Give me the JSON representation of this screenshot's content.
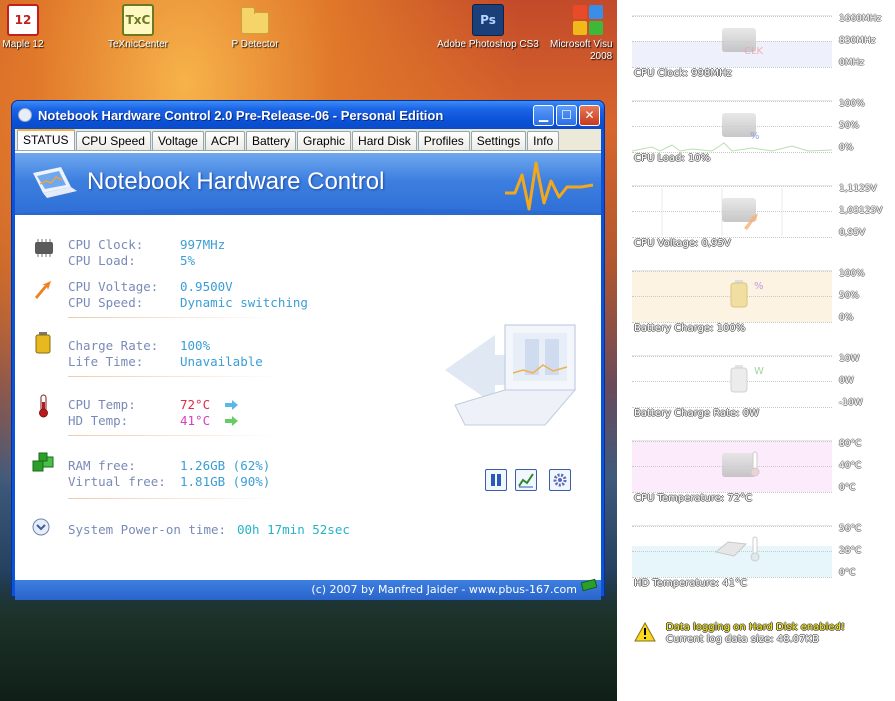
{
  "desktop": {
    "icons": [
      {
        "id": "maple",
        "label": "Maple 12",
        "glyph": "12"
      },
      {
        "id": "texnic",
        "label": "TeXnicCenter",
        "glyph": "TxC"
      },
      {
        "id": "pdetector",
        "label": "P Detector",
        "glyph": ""
      },
      {
        "id": "photoshop",
        "label": "Adobe Photoshop CS3",
        "glyph": "Ps"
      },
      {
        "id": "msvisual",
        "label_line1": "Microsoft Visu",
        "label_line2": "2008"
      }
    ]
  },
  "window": {
    "title": "Notebook Hardware Control 2.0 Pre-Release-06  -  Personal Edition",
    "tabs": [
      "STATUS",
      "CPU Speed",
      "Voltage",
      "ACPI",
      "Battery",
      "Graphic",
      "Hard Disk",
      "Profiles",
      "Settings",
      "Info"
    ],
    "active_tab": "STATUS",
    "banner_title": "Notebook Hardware Control",
    "status": {
      "cpu_clock_label": "CPU Clock:",
      "cpu_clock_value": "997MHz",
      "cpu_load_label": "CPU Load:",
      "cpu_load_value": "5%",
      "cpu_voltage_label": "CPU Voltage:",
      "cpu_voltage_value": "0.9500V",
      "cpu_speed_label": "CPU Speed:",
      "cpu_speed_value": "Dynamic switching",
      "charge_rate_label": "Charge Rate:",
      "charge_rate_value": "100%",
      "life_time_label": "Life Time:",
      "life_time_value": "Unavailable",
      "cpu_temp_label": "CPU Temp:",
      "cpu_temp_value": "72°C",
      "hd_temp_label": "HD Temp:",
      "hd_temp_value": "41°C",
      "ram_free_label": "RAM free:",
      "ram_free_value": "1.26GB (62%)",
      "virtual_free_label": "Virtual free:",
      "virtual_free_value": "1.81GB (90%)",
      "power_on_label": "System Power-on time:",
      "power_on_value": "00h  17min  52sec"
    },
    "footer": "(c) 2007 by Manfred Jaider - www.pbus-167.com",
    "colors": {
      "accent": "#0a53d8",
      "label": "#7a8ab8",
      "value": "#3a9ed6",
      "cpu_temp": "#e02d4a",
      "hd_temp": "#d93fbf",
      "power_on": "#26b3c8"
    }
  },
  "gadgets": [
    {
      "id": "cpu-clock",
      "label": "CPU Clock: 998MHz",
      "axis": [
        "1660MHz",
        "830MHz",
        "0MHz"
      ],
      "overlay": "CLK",
      "bg": "#eef0fb"
    },
    {
      "id": "cpu-load",
      "label": "CPU Load: 10%",
      "axis": [
        "100%",
        "50%",
        "0%"
      ],
      "overlay": "%",
      "bg": "#ffffff"
    },
    {
      "id": "cpu-voltage",
      "label": "CPU Voltage: 0,95V",
      "axis": [
        "1,1125V",
        "1,03125V",
        "0,95V"
      ],
      "overlay": "",
      "bg": "#ffffff"
    },
    {
      "id": "battery-charge",
      "label": "Battery Charge: 100%",
      "axis": [
        "100%",
        "50%",
        "0%"
      ],
      "overlay": "%",
      "bg": "#fdf3e2"
    },
    {
      "id": "battery-rate",
      "label": "Battery Charge Rate: 0W",
      "axis": [
        "10W",
        "0W",
        "-10W"
      ],
      "overlay": "W",
      "bg": "#ffffff"
    },
    {
      "id": "cpu-temp",
      "label": "CPU Temperature: 72°C",
      "axis": [
        "80°C",
        "40°C",
        "0°C"
      ],
      "overlay": "",
      "bg": "#fcebfa"
    },
    {
      "id": "hd-temp",
      "label": "HD Temperature: 41°C",
      "axis": [
        "56°C",
        "28°C",
        "0°C"
      ],
      "overlay": "",
      "bg": "#e7f6fb"
    }
  ],
  "notice": {
    "line1": "Data logging on Hard Disk enabled!",
    "line2": "Current log data size: 48.07KB"
  }
}
